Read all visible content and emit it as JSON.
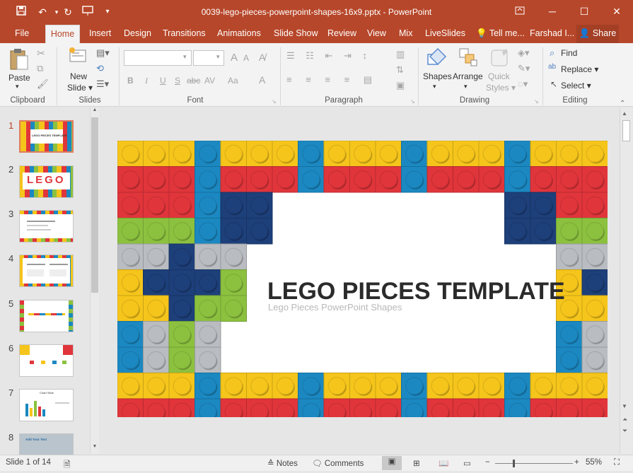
{
  "window": {
    "title": "0039-lego-pieces-powerpoint-shapes-16x9.pptx - PowerPoint",
    "accent": "#b7472a"
  },
  "quick_access": {
    "save_icon": "save-icon",
    "undo_icon": "undo-icon",
    "redo_icon": "redo-icon",
    "present_icon": "start-from-beginning-icon",
    "customize_icon": "customize-qat-icon"
  },
  "tabs": [
    "File",
    "Home",
    "Insert",
    "Design",
    "Transitions",
    "Animations",
    "Slide Show",
    "Review",
    "View",
    "Mix",
    "LiveSlides",
    "Tell me...",
    "Farshad I...",
    "Share"
  ],
  "ribbon": {
    "clipboard": {
      "paste": "Paste",
      "label": "Clipboard"
    },
    "slides": {
      "new_slide_1": "New",
      "new_slide_2": "Slide",
      "label": "Slides"
    },
    "font": {
      "label": "Font",
      "bold": "B",
      "italic": "I",
      "underline": "U",
      "strike": "S",
      "abc": "abc",
      "spacing": "AV",
      "case": "Aa",
      "color": "A",
      "grow": "A",
      "shrink": "A"
    },
    "paragraph": {
      "label": "Paragraph"
    },
    "drawing": {
      "shapes": "Shapes",
      "arrange": "Arrange",
      "quick_1": "Quick",
      "quick_2": "Styles",
      "label": "Drawing"
    },
    "editing": {
      "find": "Find",
      "replace": "Replace",
      "select": "Select",
      "label": "Editing"
    }
  },
  "slides_pane": {
    "numbers": [
      "1",
      "2",
      "3",
      "4",
      "5",
      "6",
      "7",
      "8"
    ],
    "thumb_texts": [
      "LEGO PIECES TEMPLATE",
      "LEGO",
      "",
      "",
      "",
      "",
      "Chart Slide",
      "Add Your Text"
    ]
  },
  "slide": {
    "title": "LEGO PIECES TEMPLATE",
    "subtitle": "Lego Pieces PowerPoint Shapes",
    "colors": {
      "yellow": "#f5c51b",
      "red": "#e0353b",
      "blue": "#1b88c1",
      "navy": "#1d3f7a",
      "green": "#8cc13f",
      "gray": "#b9bcc0"
    }
  },
  "status": {
    "slide_info": "Slide 1 of 14",
    "notes": "Notes",
    "comments": "Comments",
    "zoom": "55%"
  }
}
